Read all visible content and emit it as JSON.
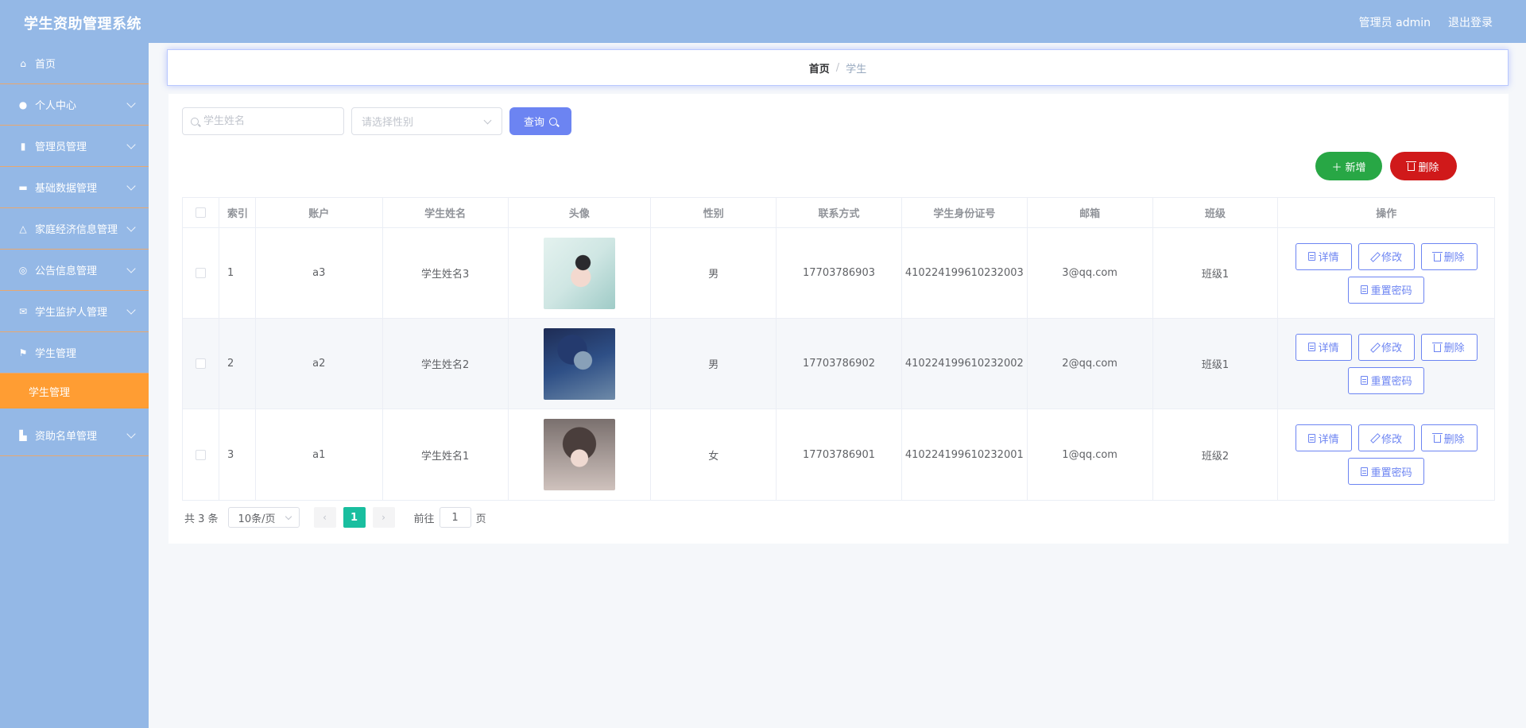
{
  "header": {
    "title": "学生资助管理系统",
    "user_label": "管理员 admin",
    "logout_label": "退出登录"
  },
  "sidebar": {
    "items": [
      {
        "label": "首页",
        "icon": "home-icon"
      },
      {
        "label": "个人中心",
        "icon": "user-icon"
      },
      {
        "label": "管理员管理",
        "icon": "chart-icon"
      },
      {
        "label": "基础数据管理",
        "icon": "briefcase-icon"
      },
      {
        "label": "家庭经济信息管理",
        "icon": "bell-icon"
      },
      {
        "label": "公告信息管理",
        "icon": "compass-icon"
      },
      {
        "label": "学生监护人管理",
        "icon": "mail-icon"
      },
      {
        "label": "学生管理",
        "icon": "flag-icon"
      },
      {
        "label": "资助名单管理",
        "icon": "thumb-icon"
      }
    ],
    "active_sub": "学生管理"
  },
  "breadcrumb": {
    "home": "首页",
    "separator": "/",
    "current": "学生"
  },
  "search": {
    "name_placeholder": "学生姓名",
    "gender_placeholder": "请选择性别",
    "query_label": "查询"
  },
  "toolbar": {
    "add_label": "新增",
    "delete_label": "删除"
  },
  "table": {
    "columns": [
      "索引",
      "账户",
      "学生姓名",
      "头像",
      "性别",
      "联系方式",
      "学生身份证号",
      "邮箱",
      "班级",
      "操作"
    ],
    "rows": [
      {
        "index": "1",
        "account": "a3",
        "name": "学生姓名3",
        "gender": "男",
        "phone": "17703786903",
        "id_card": "410224199610232003",
        "email": "3@qq.com",
        "class": "班级1"
      },
      {
        "index": "2",
        "account": "a2",
        "name": "学生姓名2",
        "gender": "男",
        "phone": "17703786902",
        "id_card": "410224199610232002",
        "email": "2@qq.com",
        "class": "班级1"
      },
      {
        "index": "3",
        "account": "a1",
        "name": "学生姓名1",
        "gender": "女",
        "phone": "17703786901",
        "id_card": "410224199610232001",
        "email": "1@qq.com",
        "class": "班级2"
      }
    ],
    "actions": {
      "detail": "详情",
      "edit": "修改",
      "delete": "删除",
      "reset_password": "重置密码"
    }
  },
  "pagination": {
    "total": "共 3 条",
    "page_size": "10条/页",
    "current_page": "1",
    "goto_label": "前往",
    "goto_value": "1",
    "page_suffix": "页"
  },
  "colors": {
    "header_bg": "#94b8e6",
    "accent": "#6c84f2",
    "active_menu": "#ff9d33",
    "add_button": "#28a745",
    "delete_button": "#d0191a",
    "current_page": "#19be9f"
  }
}
